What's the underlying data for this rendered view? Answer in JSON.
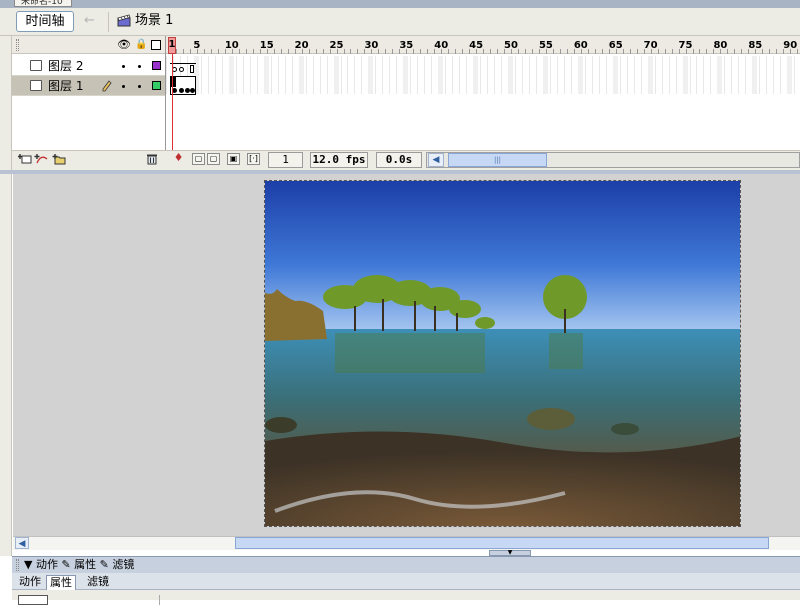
{
  "doc_tab": {
    "label": "未命名-10"
  },
  "edit_bar": {
    "timeline_button": "时间轴",
    "back_arrow": "←",
    "scene_label": "场景 1"
  },
  "timeline": {
    "header_icons": {
      "eye": "eye-icon",
      "lock": "lock-icon",
      "outline": "outline-icon"
    },
    "ruler_ticks": [
      "1",
      "5",
      "10",
      "15",
      "20",
      "25",
      "30",
      "35",
      "40",
      "45",
      "50",
      "55",
      "60",
      "65",
      "70",
      "75",
      "80",
      "85",
      "90"
    ],
    "layers": [
      {
        "name": "图层 2",
        "color": "#9933cc",
        "selected": false,
        "pencil": false
      },
      {
        "name": "图层 1",
        "color": "#33cc66",
        "selected": true,
        "pencil": true
      }
    ],
    "current_frame": "1",
    "fps": "12.0 fps",
    "elapsed": "0.0s"
  },
  "properties_panel": {
    "header": "▼ 动作 ✎ 属性 ✎ 滤镜",
    "tabs": [
      "动作",
      "属性",
      "滤镜"
    ],
    "active_tab": "属性"
  },
  "colors": {
    "panel_bg": "#ecebe4",
    "stage_bg": "#d2d2d2",
    "accent_blue": "#c6d8f4",
    "playhead": "#e03030"
  }
}
